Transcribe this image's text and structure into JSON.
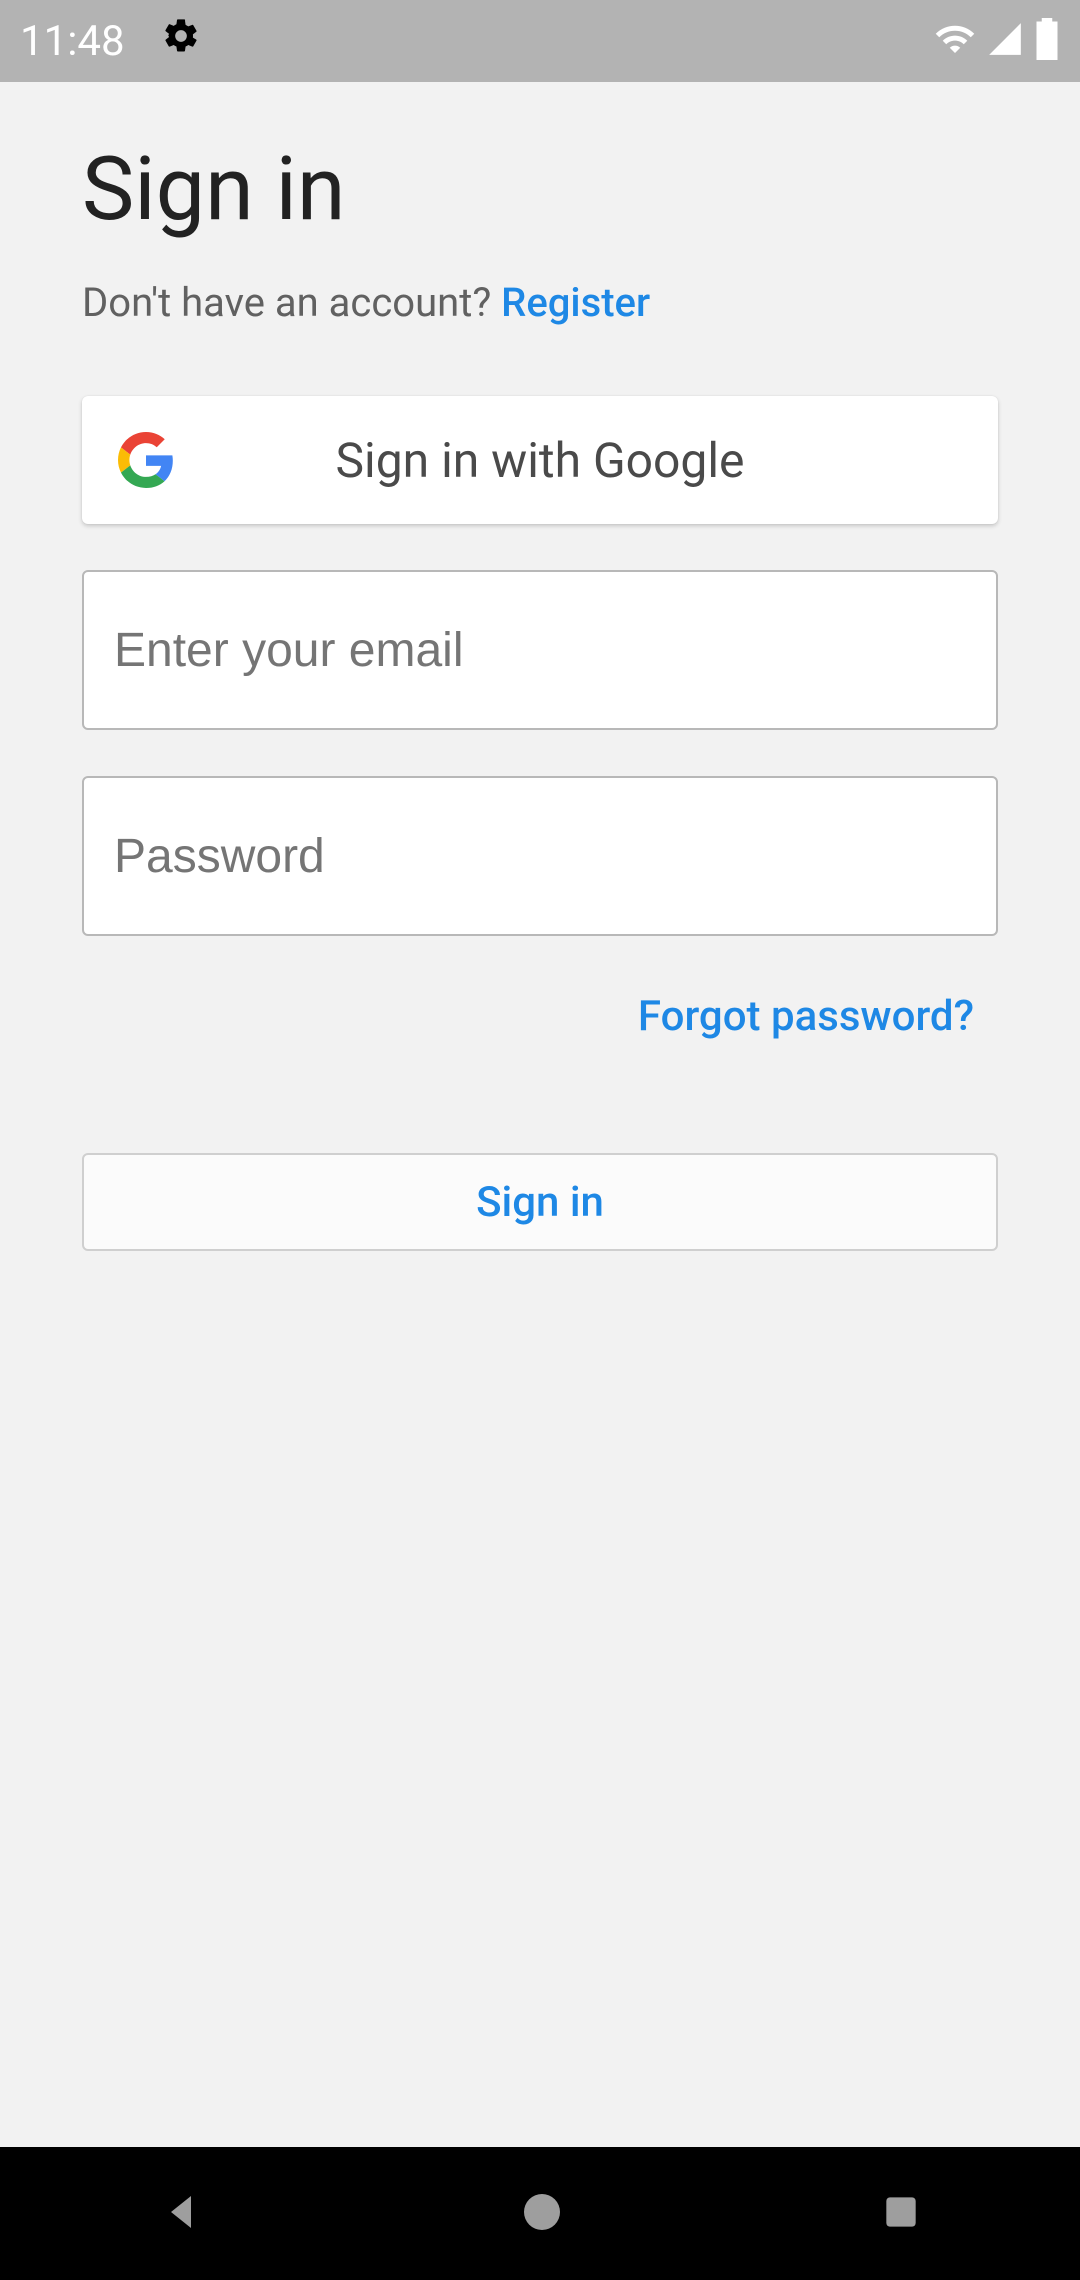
{
  "status": {
    "time": "11:48"
  },
  "page": {
    "title": "Sign in",
    "subtitle_prefix": "Don't have an account? ",
    "register_label": "Register",
    "google_button": "Sign in with Google",
    "email_placeholder": "Enter your email",
    "password_placeholder": "Password",
    "forgot_label": "Forgot password?",
    "signin_button": "Sign in"
  }
}
